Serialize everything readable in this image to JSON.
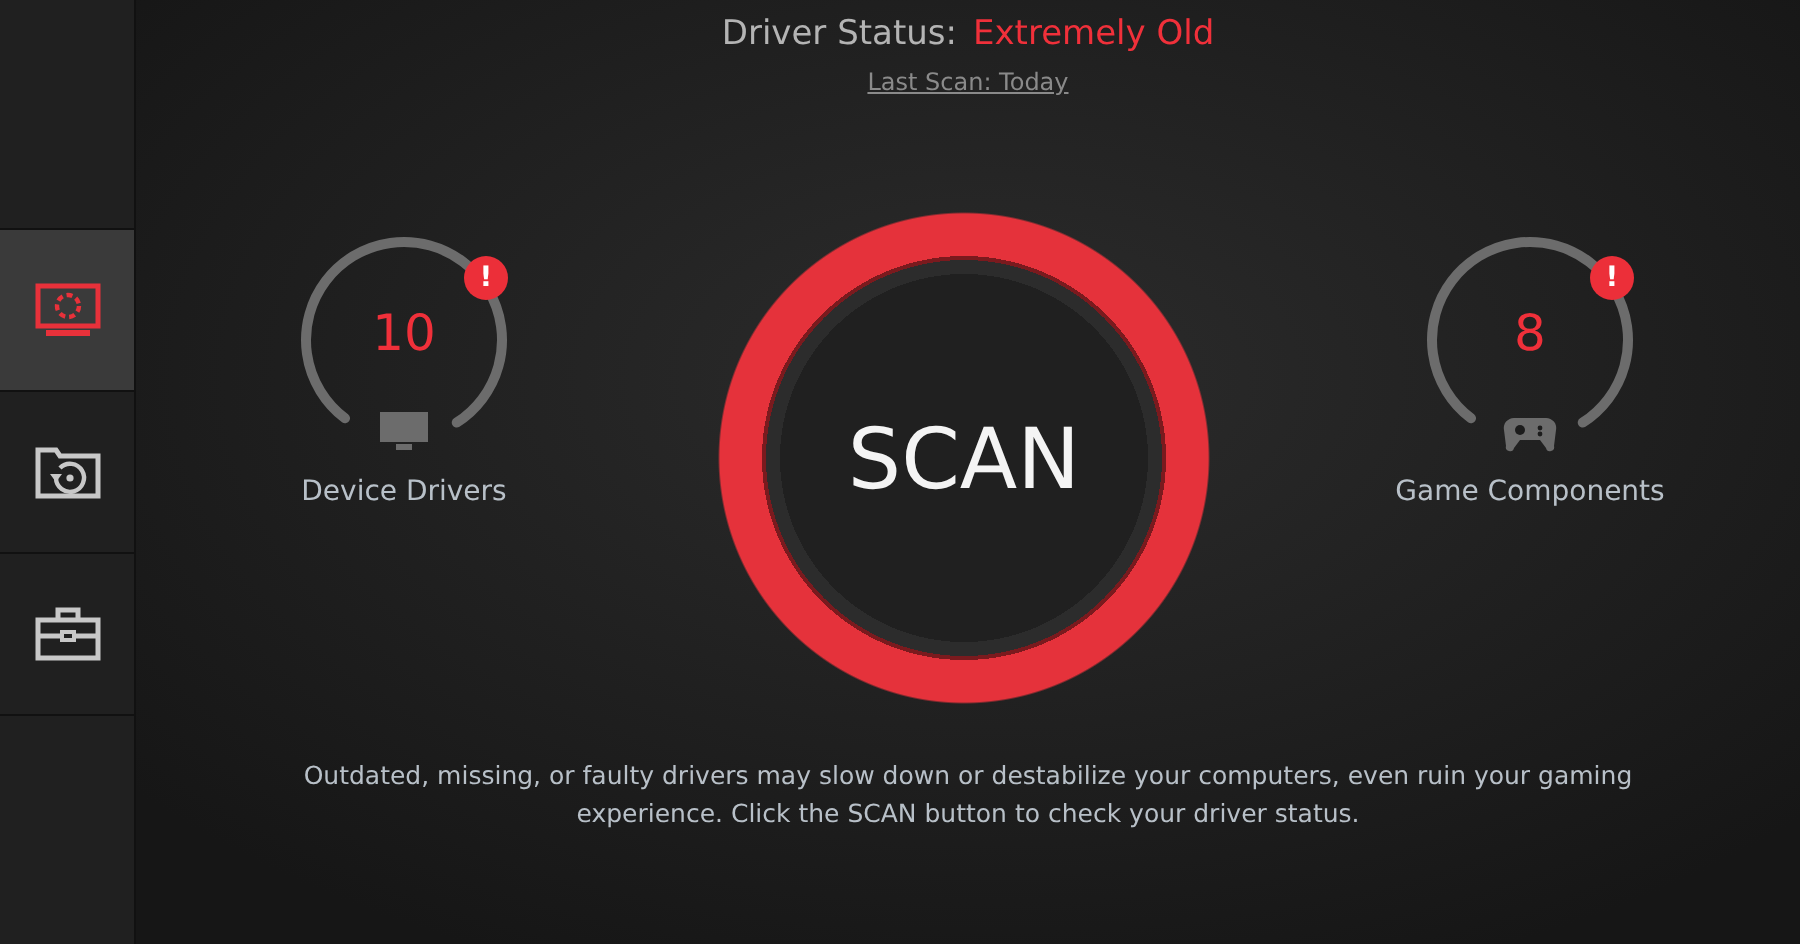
{
  "sidebar": {
    "items": [
      {
        "kind": "monitor",
        "selected": true
      },
      {
        "kind": "restore",
        "selected": false
      },
      {
        "kind": "toolbox",
        "selected": false
      }
    ]
  },
  "status": {
    "label": "Driver Status:",
    "value": "Extremely Old",
    "last_scan": "Last Scan: Today"
  },
  "gauges": [
    {
      "kind": "monitor",
      "count": "10",
      "alert": "!",
      "label": "Device Drivers"
    },
    {
      "kind": "gamepad",
      "count": "8",
      "alert": "!",
      "label": "Game Components"
    }
  ],
  "scan_button": "SCAN",
  "description": "Outdated, missing, or faulty drivers may slow down or destabilize your computers, even ruin your gaming experience. Click the SCAN button to check your driver status."
}
